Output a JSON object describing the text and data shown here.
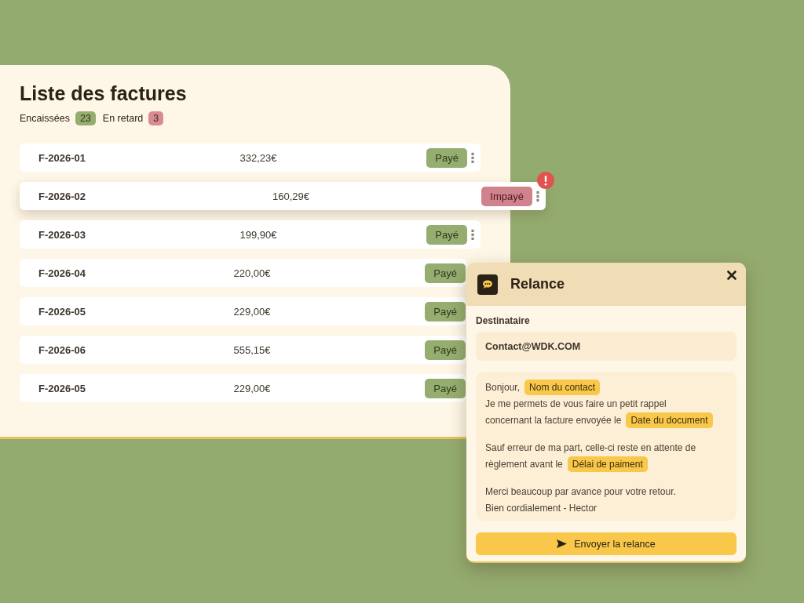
{
  "invoices": {
    "title": "Liste des factures",
    "stats": [
      {
        "label": "Encaissées",
        "count": "23",
        "color": "#96ad70"
      },
      {
        "label": "En retard",
        "count": "3",
        "color": "#d98a93"
      }
    ],
    "rows": [
      {
        "id": "F-2026-01",
        "amount": "332,23€",
        "status": {
          "kind": "paid",
          "label": "Payé"
        },
        "selected": false,
        "alert": false,
        "menu": "⋮"
      },
      {
        "id": "F-2026-02",
        "amount": "160,29€",
        "status": {
          "kind": "unpaid",
          "label": "Impayé"
        },
        "selected": true,
        "alert": true,
        "menu": "⋮"
      },
      {
        "id": "F-2026-03",
        "amount": "199,90€",
        "status": {
          "kind": "paid",
          "label": "Payé"
        },
        "selected": false,
        "alert": false,
        "menu": "⋮"
      },
      {
        "id": "F-2026-04",
        "amount": "220,00€",
        "status": {
          "kind": "paid",
          "label": "Payé"
        },
        "selected": false,
        "alert": false
      },
      {
        "id": "F-2026-05",
        "amount": "229,00€",
        "status": {
          "kind": "paid",
          "label": "Payé"
        },
        "selected": false,
        "alert": false
      },
      {
        "id": "F-2026-06",
        "amount": "555,15€",
        "status": {
          "kind": "paid",
          "label": "Payé"
        },
        "selected": false,
        "alert": false
      },
      {
        "id": "F-2026-05",
        "amount": "229,00€",
        "status": {
          "kind": "paid",
          "label": "Payé"
        },
        "selected": false,
        "alert": false
      }
    ]
  },
  "reminder": {
    "title": "Relance",
    "recipient_label": "Destinataire",
    "recipient": "Contact@WDK.COM",
    "message": [
      [
        [
          {
            "kind": "text",
            "text": "Bonjour,"
          },
          {
            "kind": "tag",
            "text": "Nom du contact"
          }
        ],
        [
          {
            "kind": "text",
            "text": "Je me permets de vous faire un petit rappel"
          }
        ],
        [
          {
            "kind": "text",
            "text": "concernant la facture envoyée le"
          },
          {
            "kind": "tag",
            "text": "Date du document"
          }
        ]
      ],
      [
        [
          {
            "kind": "text",
            "text": "Sauf erreur de ma part, celle-ci reste en attente de"
          }
        ],
        [
          {
            "kind": "text",
            "text": "règlement avant le"
          },
          {
            "kind": "tag",
            "text": "Délai de paiment"
          }
        ]
      ],
      [
        [
          {
            "kind": "text",
            "text": "Merci beaucoup par avance pour votre retour."
          }
        ],
        [
          {
            "kind": "text",
            "text": "Bien cordialement - Hector"
          }
        ]
      ]
    ],
    "send_button": "Envoyer la relance"
  }
}
